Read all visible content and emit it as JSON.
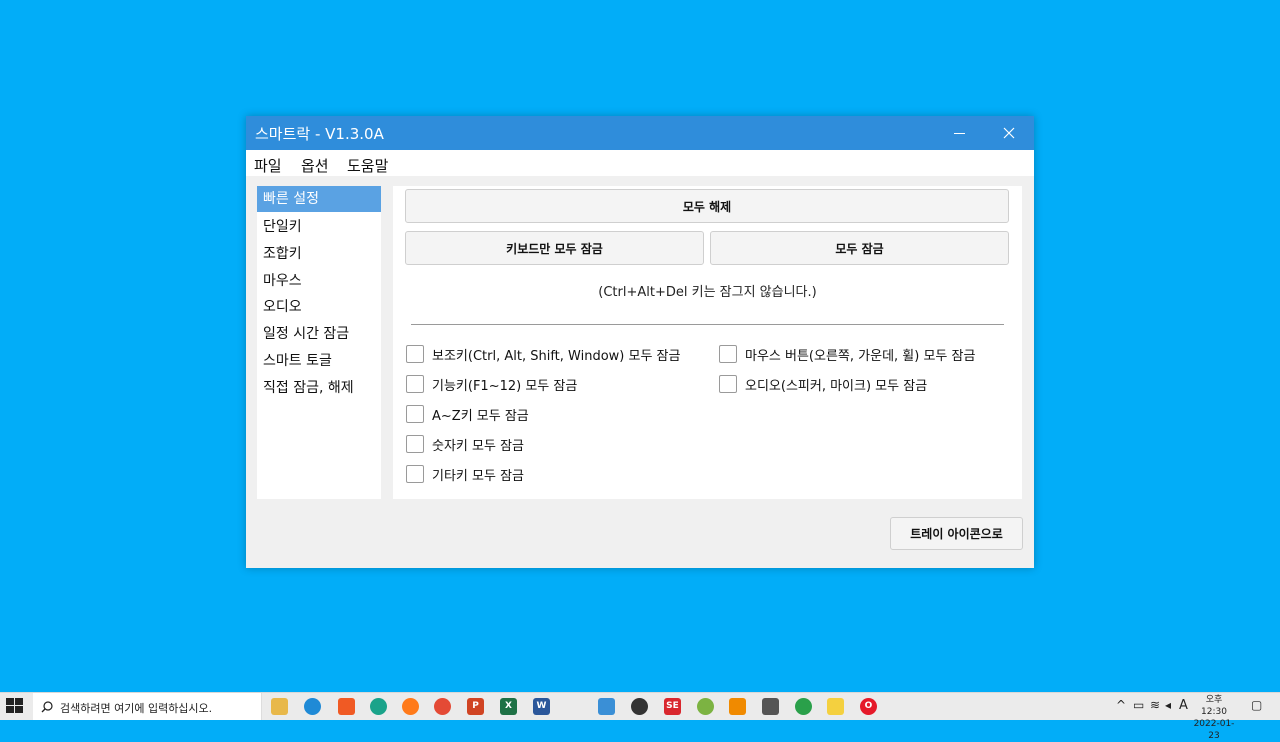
{
  "window": {
    "title": "스마트락 - V1.3.0A"
  },
  "menu": {
    "items": [
      "파일",
      "옵션",
      "도움말"
    ]
  },
  "nav": {
    "items": [
      "빠른 설정",
      "단일키",
      "조합키",
      "마우스",
      "오디오",
      "일정 시간 잠금",
      "스마트 토글",
      "직접 잠금, 해제"
    ],
    "active_index": 0
  },
  "panel": {
    "unlock_all_label": "모두 해제",
    "lock_keyboard_label": "키보드만 모두 잠금",
    "lock_all_label": "모두 잠금",
    "note": "(Ctrl+Alt+Del 키는 잠그지 않습니다.)",
    "left_checks": [
      "보조키(Ctrl, Alt, Shift, Window) 모두 잠금",
      "기능키(F1~12) 모두 잠금",
      "A~Z키 모두 잠금",
      "숫자키 모두 잠금",
      "기타키 모두 잠금"
    ],
    "right_checks": [
      "마우스 버튼(오른쪽, 가운데, 휠) 모두 잠금",
      "오디오(스피커, 마이크) 모두 잠금"
    ]
  },
  "footer": {
    "tray_button_label": "트레이 아이콘으로"
  },
  "taskbar": {
    "search_placeholder": "검색하려면 여기에 입력하십시오.",
    "ime_indicator": "A",
    "clock_time": "오후 12:30",
    "clock_date": "2022-01-23",
    "apps": [
      "file-explorer-icon",
      "edge-icon",
      "brave-icon",
      "app-icon",
      "firefox-icon",
      "chrome-icon",
      "powerpoint-icon",
      "excel-icon",
      "word-icon",
      "remote-desktop-icon",
      "search-app-icon",
      "se-icon",
      "android-icon",
      "vlc-icon",
      "calculator-icon",
      "chrome-alt-icon",
      "sticky-notes-icon",
      "opera-icon"
    ]
  },
  "colors": {
    "desktop": "#02adf8",
    "titlebar": "#2f8ddb",
    "nav_active": "#5aa2e3"
  }
}
